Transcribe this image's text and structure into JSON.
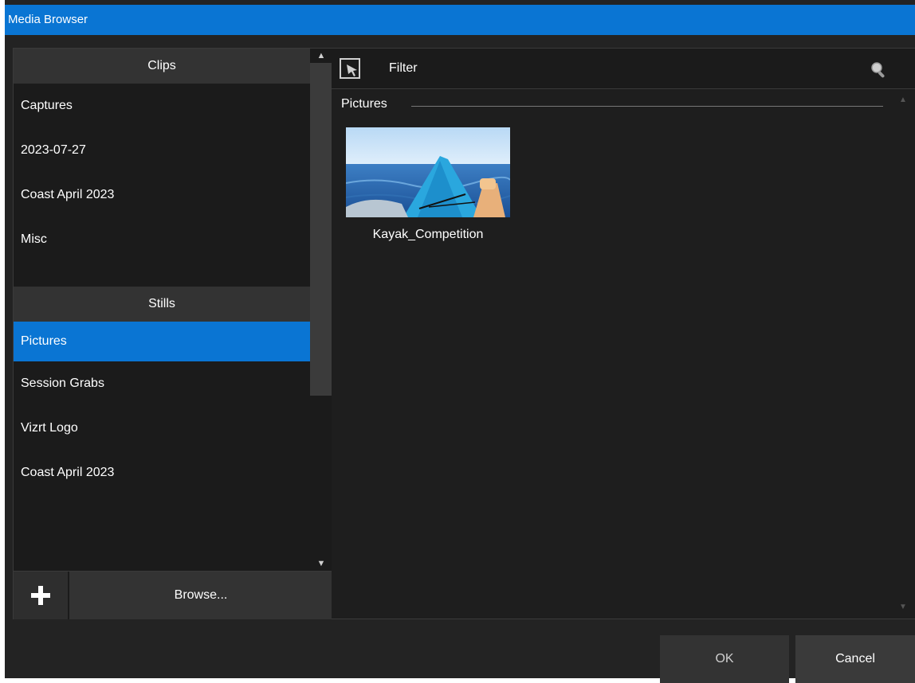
{
  "window": {
    "title": "Media Browser"
  },
  "sidebar": {
    "clips_header": "Clips",
    "clips": [
      {
        "label": "Captures"
      },
      {
        "label": "2023-07-27"
      },
      {
        "label": "Coast April 2023"
      },
      {
        "label": "Misc"
      }
    ],
    "stills_header": "Stills",
    "stills": [
      {
        "label": "Pictures",
        "selected": true
      },
      {
        "label": "Session Grabs"
      },
      {
        "label": "Vizrt Logo"
      },
      {
        "label": "Coast April 2023"
      }
    ],
    "add_icon": "plus-icon",
    "browse_label": "Browse..."
  },
  "browser": {
    "select_icon": "selection-cursor-icon",
    "filter_label": "Filter",
    "search_icon": "search-icon",
    "group_title": "Pictures",
    "items": [
      {
        "caption": "Kayak_Competition"
      }
    ]
  },
  "footer": {
    "ok_label": "OK",
    "cancel_label": "Cancel"
  },
  "colors": {
    "accent": "#0a75d3",
    "background": "#232323",
    "panel": "#1b1b1b",
    "header": "#333333"
  }
}
